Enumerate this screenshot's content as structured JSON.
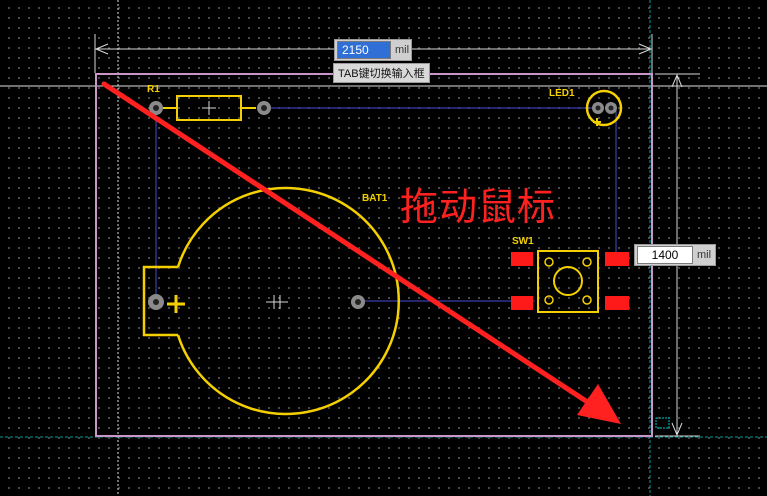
{
  "board": {
    "width_input": {
      "value": "2150",
      "unit": "mil"
    },
    "height_input": {
      "value": "1400",
      "unit": "mil"
    },
    "tooltip": "TAB键切换输入框"
  },
  "components": {
    "r1": "R1",
    "led1": "LED1",
    "bat1": "BAT1",
    "sw1": "SW1"
  },
  "annotation": {
    "text": "拖动鼠标"
  },
  "colors": {
    "background": "#000000",
    "board_outline": "#c896c8",
    "silkscreen": "#f5d000",
    "pad_red": "#ff1a1a",
    "arrow": "#ff2020",
    "ratsnest": "#4a4ad8",
    "guide": "#ffffff",
    "cyan_guide": "#00a0a0"
  }
}
